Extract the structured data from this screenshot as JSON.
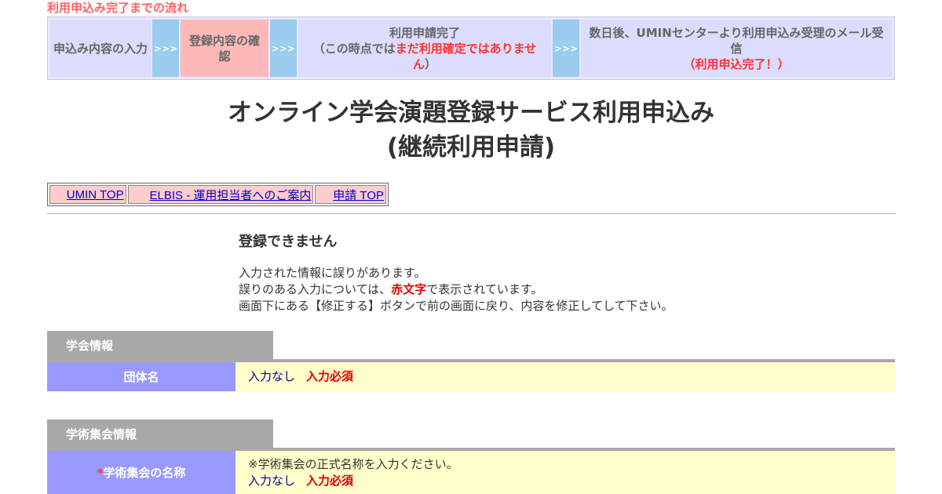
{
  "flow": {
    "label": "利用申込み完了までの流れ",
    "step1": "申込み内容の入力",
    "step2": "登録内容の確認",
    "step3_line1": "利用申請完了",
    "step3_pre": "（この時点では",
    "step3_red": "まだ利用確定ではありません",
    "step3_post": "）",
    "step4_line1": "数日後、UMINセンターより利用申込み受理のメール受信",
    "step4_red": "（利用申込完了！）",
    "arrow": ">>>"
  },
  "title": {
    "line1": "オンライン学会演題登録サービス利用申込み",
    "line2": "(継続利用申請)"
  },
  "nav": {
    "umin_top": "UMIN TOP",
    "elbis": "ELBIS - 運用担当者へのご案内",
    "apply_top": "申請 TOP"
  },
  "error": {
    "title": "登録できません",
    "line1": "入力された情報に誤りがあります。",
    "line2_pre": "誤りのある入力については、",
    "line2_red": "赤文字",
    "line2_post": "で表示されています。",
    "line3": "画面下にある【修正する】ボタンで前の画面に戻り、内容を修正してして下さい。"
  },
  "section1": {
    "header": "学会情報",
    "row_label": "団体名",
    "val_none": "入力なし",
    "val_req": "入力必須"
  },
  "section2": {
    "header": "学術集会情報",
    "asterisk": "*",
    "row_label": "学術集会の名称",
    "note": "※学術集会の正式名称を入力ください。",
    "val_none": "入力なし",
    "val_req": "入力必須"
  },
  "colors": {
    "flow_red": "#ff3333",
    "step_bg": "#dcdcff",
    "active_step_bg": "#ffb8b8",
    "arrow_bg": "#99ccee",
    "label_bg": "#9999ff",
    "value_bg": "#ffffcc",
    "section_bg": "#a8a8a8",
    "nav_bg": "#ffcccc"
  }
}
